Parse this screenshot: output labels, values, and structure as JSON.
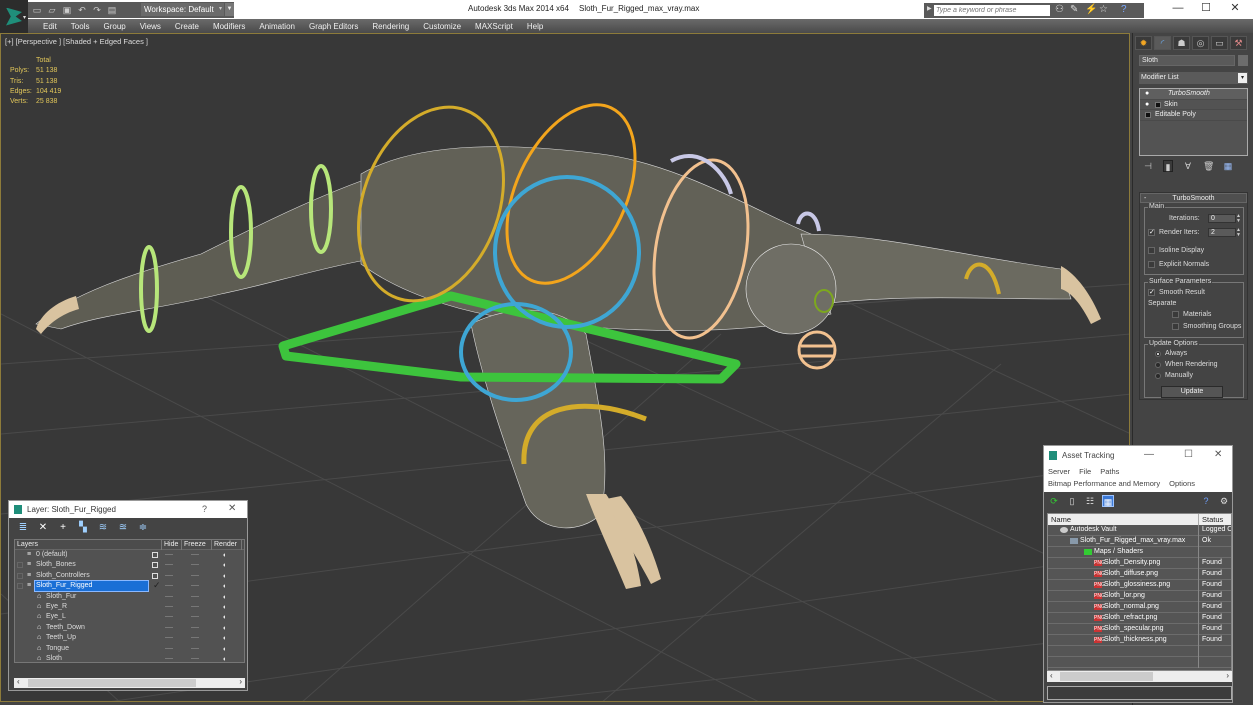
{
  "window": {
    "app_title": "Autodesk 3ds Max  2014 x64",
    "file_title": "Sloth_Fur_Rigged_max_vray.max",
    "workspace": "Workspace: Default",
    "search_placeholder": "Type a keyword or phrase",
    "minimize": "—",
    "maximize": "☐",
    "close": "✕"
  },
  "menu": [
    "Edit",
    "Tools",
    "Group",
    "Views",
    "Create",
    "Modifiers",
    "Animation",
    "Graph Editors",
    "Rendering",
    "Customize",
    "MAXScript",
    "Help"
  ],
  "viewport": {
    "label": "[+] [Perspective ] [Shaded + Edged Faces ]",
    "stats": {
      "header": "Total",
      "rows": [
        {
          "key": "Polys:",
          "value": "51 138"
        },
        {
          "key": "Tris:",
          "value": "51 138"
        },
        {
          "key": "Edges:",
          "value": "104 419"
        },
        {
          "key": "Verts:",
          "value": "25 838"
        }
      ]
    },
    "colors": {
      "background": "#383838",
      "grid": "#4a4a4a",
      "ring_yellow": "#d4ac2a",
      "ring_orange": "#f3a51c",
      "ring_blue": "#3ea6d4",
      "ring_lime": "#b7e67a",
      "ring_peach": "#f2c18f",
      "ring_lavender": "#c8c8e6",
      "base_green": "#3dc43d"
    }
  },
  "command_panel": {
    "object_name": "Sloth",
    "modifier_list": "Modifier List",
    "stack": [
      {
        "label": "TurboSmooth",
        "italic": true
      },
      {
        "label": "Skin",
        "italic": false
      },
      {
        "label": "Editable Poly",
        "italic": false
      }
    ],
    "rollout": {
      "title": "TurboSmooth",
      "main_group": "Main",
      "iterations_label": "Iterations:",
      "iterations_value": "0",
      "render_iters_label": "Render Iters:",
      "render_iters_value": "2",
      "render_iters_checked": true,
      "isoline_display": "Isoline Display",
      "explicit_normals": "Explicit Normals",
      "surface_group": "Surface Parameters",
      "smooth_result": "Smooth Result",
      "separate": "Separate",
      "materials": "Materials",
      "smoothing_groups": "Smoothing Groups",
      "update_group": "Update Options",
      "always": "Always",
      "when_rendering": "When Rendering",
      "manually": "Manually",
      "update_button": "Update"
    }
  },
  "layer_dialog": {
    "title": "Layer: Sloth_Fur_Rigged",
    "help": "?",
    "close": "✕",
    "columns": [
      "Layers",
      "Hide",
      "Freeze",
      "Render",
      "C"
    ],
    "rows": [
      {
        "name": "0 (default)",
        "level": 0,
        "checkbox": true,
        "selected": false
      },
      {
        "name": "Sloth_Bones",
        "level": 0,
        "checkbox": true,
        "selected": false
      },
      {
        "name": "Sloth_Controllers",
        "level": 0,
        "checkbox": true,
        "selected": false
      },
      {
        "name": "Sloth_Fur_Rigged",
        "level": 0,
        "checkbox": false,
        "selected": true
      },
      {
        "name": "Sloth_Fur",
        "level": 1,
        "checkbox": false,
        "selected": false
      },
      {
        "name": "Eye_R",
        "level": 1,
        "checkbox": false,
        "selected": false
      },
      {
        "name": "Eye_L",
        "level": 1,
        "checkbox": false,
        "selected": false
      },
      {
        "name": "Teeth_Down",
        "level": 1,
        "checkbox": false,
        "selected": false
      },
      {
        "name": "Teeth_Up",
        "level": 1,
        "checkbox": false,
        "selected": false
      },
      {
        "name": "Tongue",
        "level": 1,
        "checkbox": false,
        "selected": false
      },
      {
        "name": "Sloth",
        "level": 1,
        "checkbox": false,
        "selected": false
      }
    ]
  },
  "asset_tracking": {
    "title": "Asset Tracking",
    "menu1": [
      "Server",
      "File",
      "Paths"
    ],
    "menu2": [
      "Bitmap Performance and Memory",
      "Options"
    ],
    "columns": [
      "Name",
      "Status"
    ],
    "rows": [
      {
        "name": "Autodesk Vault",
        "status": "Logged O",
        "icon": "vault",
        "level": 0
      },
      {
        "name": "Sloth_Fur_Rigged_max_vray.max",
        "status": "Ok",
        "icon": "max",
        "level": 1
      },
      {
        "name": "Maps / Shaders",
        "status": "",
        "icon": "folder",
        "level": 2
      },
      {
        "name": "Sloth_Density.png",
        "status": "Found",
        "icon": "png",
        "level": 3
      },
      {
        "name": "Sloth_diffuse.png",
        "status": "Found",
        "icon": "png",
        "level": 3
      },
      {
        "name": "Sloth_glossiness.png",
        "status": "Found",
        "icon": "png",
        "level": 3
      },
      {
        "name": "Sloth_lor.png",
        "status": "Found",
        "icon": "png",
        "level": 3
      },
      {
        "name": "Sloth_normal.png",
        "status": "Found",
        "icon": "png",
        "level": 3
      },
      {
        "name": "Sloth_refract.png",
        "status": "Found",
        "icon": "png",
        "level": 3
      },
      {
        "name": "Sloth_specular.png",
        "status": "Found",
        "icon": "png",
        "level": 3
      },
      {
        "name": "Sloth_thickness.png",
        "status": "Found",
        "icon": "png",
        "level": 3
      }
    ]
  }
}
